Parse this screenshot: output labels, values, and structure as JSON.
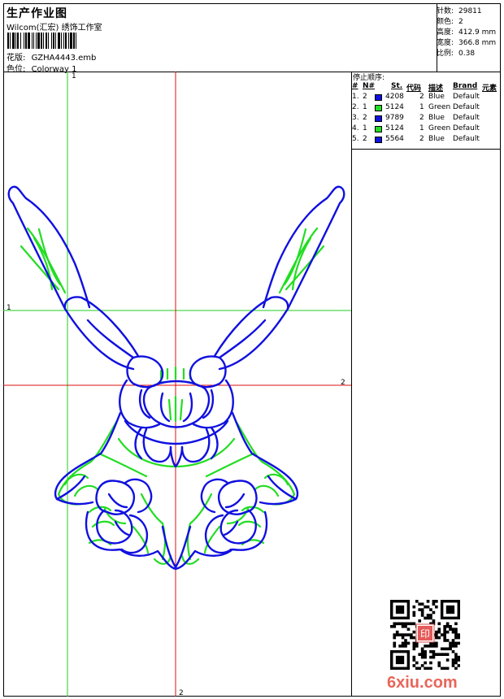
{
  "header": {
    "title": "生产作业图",
    "studio": "Wilcom(汇宏) 绣饰工作室",
    "design_label": "花版:",
    "design_value": "GZHA4443.emb",
    "colorway_label": "色位:",
    "colorway_value": "Colorway 1"
  },
  "meta": [
    {
      "label": "针数:",
      "value": "29811"
    },
    {
      "label": "颜色:",
      "value": "2"
    },
    {
      "label": "高度:",
      "value": "412.9 mm"
    },
    {
      "label": "宽度:",
      "value": "366.8 mm"
    },
    {
      "label": "比例:",
      "value": "0.38"
    }
  ],
  "stop_sequence": {
    "title": "停止顺序:",
    "headers": [
      "#",
      "N#",
      "St.",
      "代码",
      "描述",
      "Brand",
      "元素"
    ],
    "rows": [
      {
        "index": "1.",
        "needle": "2",
        "color": "#1010e0",
        "code": "4208",
        "elements": "2",
        "description": "Blue",
        "brand": "Default"
      },
      {
        "index": "2.",
        "needle": "1",
        "color": "#22dd22",
        "code": "5124",
        "elements": "1",
        "description": "Green",
        "brand": "Default"
      },
      {
        "index": "3.",
        "needle": "2",
        "color": "#1010e0",
        "code": "9789",
        "elements": "2",
        "description": "Blue",
        "brand": "Default"
      },
      {
        "index": "4.",
        "needle": "1",
        "color": "#22dd22",
        "code": "5124",
        "elements": "1",
        "description": "Green",
        "brand": "Default"
      },
      {
        "index": "5.",
        "needle": "2",
        "color": "#1010e0",
        "code": "5564",
        "elements": "2",
        "description": "Blue",
        "brand": "Default"
      }
    ]
  },
  "guides": {
    "green_label": "1",
    "red_label": "2"
  },
  "colors": {
    "thread_blue": "#1010e0",
    "thread_green": "#22dd22",
    "guide_green": "#22cc22",
    "guide_red": "#dd1111"
  },
  "watermark": "6xiu.com",
  "qr_stamp_text": "印"
}
